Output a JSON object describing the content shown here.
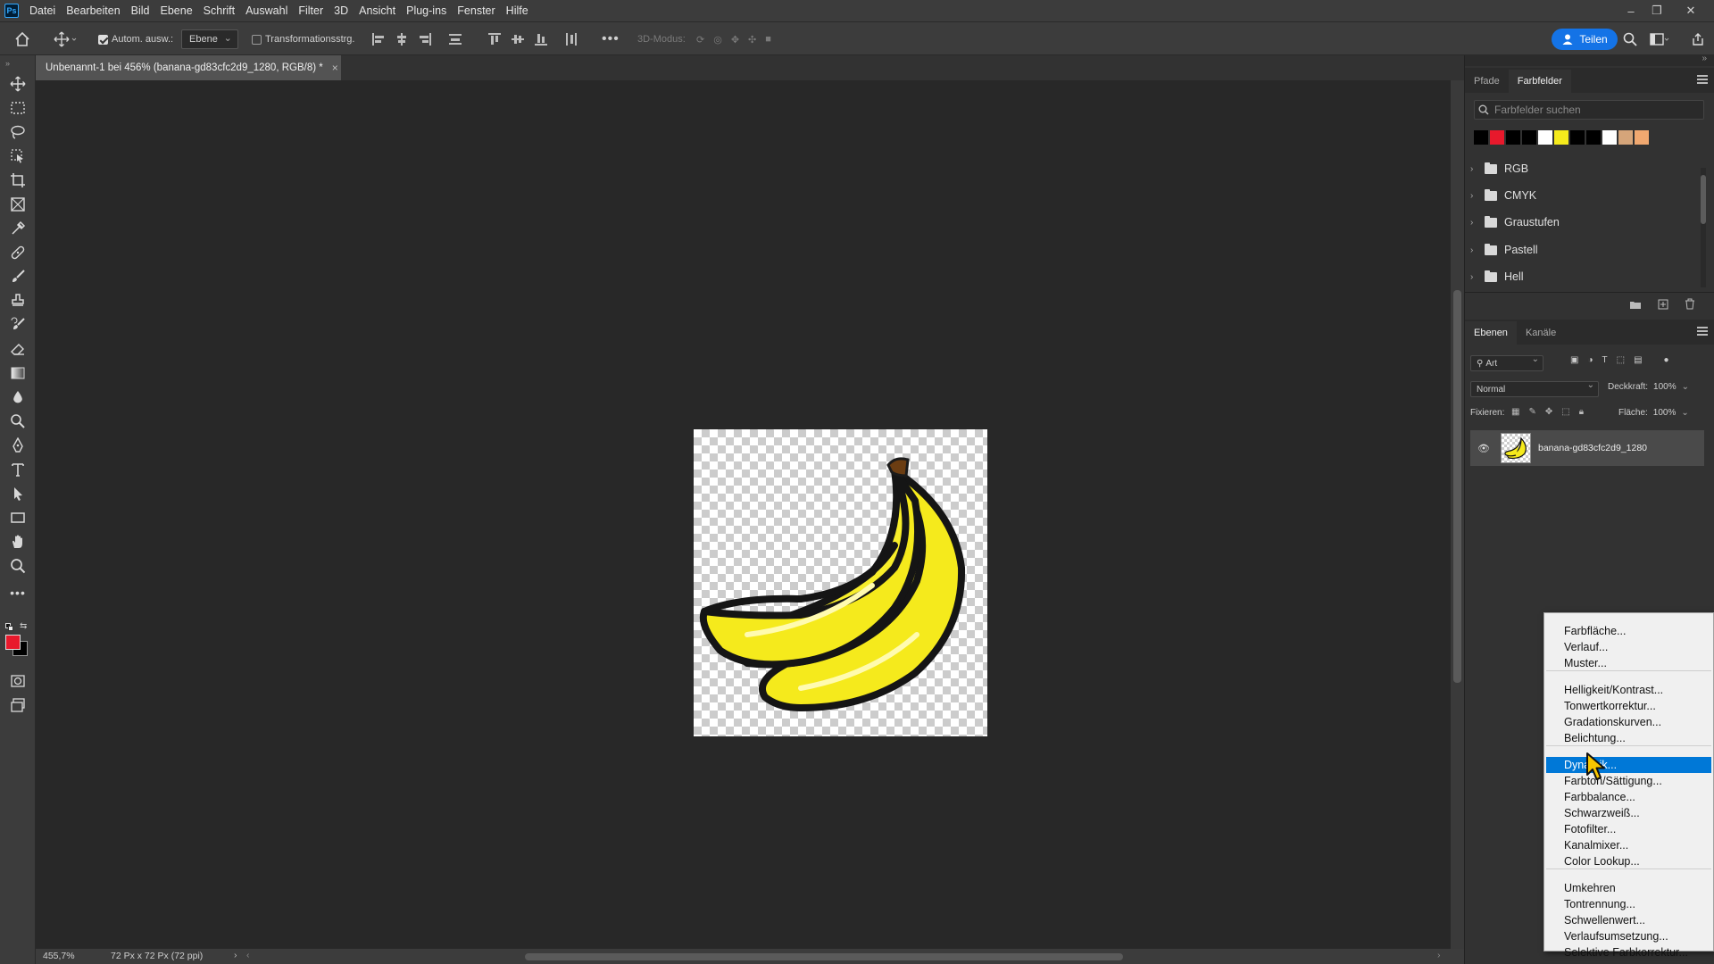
{
  "app": {
    "logo_text": "Ps"
  },
  "menubar": {
    "items": [
      "Datei",
      "Bearbeiten",
      "Bild",
      "Ebene",
      "Schrift",
      "Auswahl",
      "Filter",
      "3D",
      "Ansicht",
      "Plug-ins",
      "Fenster",
      "Hilfe"
    ]
  },
  "options_bar": {
    "auto_select_label": "Autom. ausw.:",
    "auto_select_checked": true,
    "auto_select_target": "Ebene",
    "transform_controls_label": "Transformationsstrg.",
    "transform_controls_checked": false,
    "mode_3d_label": "3D-Modus:",
    "share_label": "Teilen"
  },
  "document": {
    "tab_title": "Unbenannt-1 bei 456% (banana-gd83cfc2d9_1280, RGB/8) *",
    "zoom": "455,7%",
    "doc_info": "72 Px x 72 Px (72 ppi)"
  },
  "colors": {
    "foreground": "#e8192c",
    "background": "#000000",
    "accent": "#1473e6",
    "menu_highlight": "#0078d7",
    "banana_fill": "#f5ea1c"
  },
  "swatches_panel": {
    "tabs": [
      "Pfade",
      "Farbfelder"
    ],
    "active_tab": "Farbfelder",
    "search_placeholder": "Farbfelder suchen",
    "recent_swatches": [
      "#000000",
      "#e8192c",
      "#000000",
      "#000000",
      "#ffffff",
      "#f5ea1c",
      "#000000",
      "#000000",
      "#ffffff",
      "#d5a57a",
      "#f0a870"
    ],
    "folders": [
      "RGB",
      "CMYK",
      "Graustufen",
      "Pastell",
      "Hell"
    ]
  },
  "layers_panel": {
    "tabs": [
      "Ebenen",
      "Kanäle"
    ],
    "active_tab": "Ebenen",
    "filter_kind": "Art",
    "blend_mode": "Normal",
    "opacity_label": "Deckkraft:",
    "opacity_value": "100%",
    "lock_label": "Fixieren:",
    "fill_label": "Fläche:",
    "fill_value": "100%",
    "layer_name": "banana-gd83cfc2d9_1280"
  },
  "context_menu": {
    "groups": [
      [
        "Farbfläche...",
        "Verlauf...",
        "Muster..."
      ],
      [
        "Helligkeit/Kontrast...",
        "Tonwertkorrektur...",
        "Gradationskurven...",
        "Belichtung..."
      ],
      [
        "Dynamik...",
        "Farbton/Sättigung...",
        "Farbbalance...",
        "Schwarzweiß...",
        "Fotofilter...",
        "Kanalmixer...",
        "Color Lookup..."
      ],
      [
        "Umkehren",
        "Tontrennung...",
        "Schwellenwert...",
        "Verlaufsumsetzung...",
        "Selektive Farbkorrektur..."
      ]
    ],
    "highlighted": "Dynamik..."
  },
  "icons": {
    "toolbar": [
      "move-icon",
      "marquee-icon",
      "lasso-icon",
      "object-select-icon",
      "crop-icon",
      "frame-icon",
      "eyedropper-icon",
      "healing-brush-icon",
      "brush-icon",
      "stamp-icon",
      "history-brush-icon",
      "eraser-icon",
      "gradient-icon",
      "blur-icon",
      "dodge-icon",
      "pen-icon",
      "type-icon",
      "path-select-icon",
      "rectangle-icon",
      "hand-icon",
      "zoom-icon",
      "more-tools-icon"
    ]
  }
}
